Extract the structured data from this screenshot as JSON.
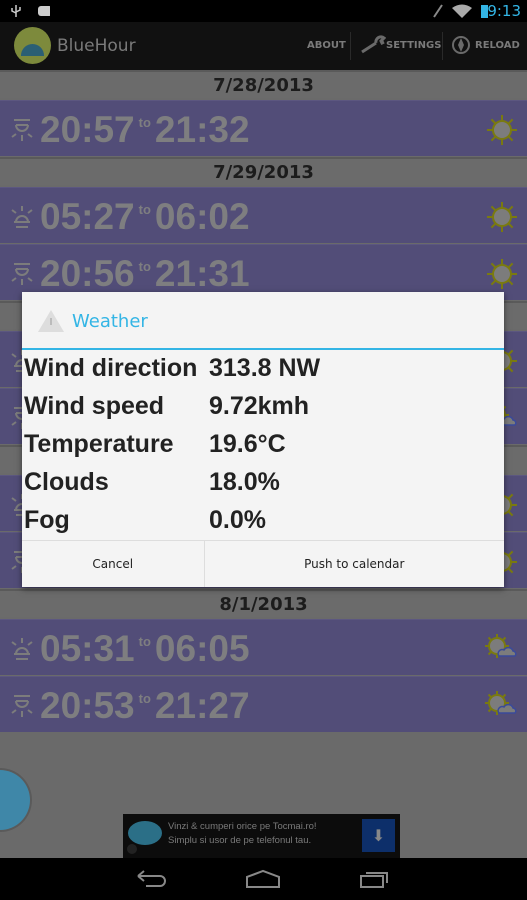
{
  "status_bar": {
    "time": "9:13"
  },
  "action_bar": {
    "title": "BlueHour",
    "about": "ABOUT",
    "settings": "SETTINGS",
    "reload": "RELOAD"
  },
  "list": [
    {
      "kind": "date",
      "label": "7/28/2013"
    },
    {
      "kind": "row",
      "event": "sunset",
      "start": "20:57",
      "to": "to",
      "end": "21:32",
      "weather": "sun"
    },
    {
      "kind": "date",
      "label": "7/29/2013"
    },
    {
      "kind": "row",
      "event": "sunrise",
      "start": "05:27",
      "to": "to",
      "end": "06:02",
      "weather": "sun"
    },
    {
      "kind": "row",
      "event": "sunset",
      "start": "20:56",
      "to": "to",
      "end": "21:31",
      "weather": "sun"
    },
    {
      "kind": "date",
      "label": ""
    },
    {
      "kind": "row",
      "event": "sunrise",
      "weather": "sun"
    },
    {
      "kind": "row",
      "event": "sunset",
      "weather": "sun-cloud"
    },
    {
      "kind": "date",
      "label": ""
    },
    {
      "kind": "row",
      "event": "sunrise",
      "weather": "sun"
    },
    {
      "kind": "row",
      "event": "sunset",
      "weather": "sun"
    },
    {
      "kind": "date",
      "label": "8/1/2013"
    },
    {
      "kind": "row",
      "event": "sunrise",
      "start": "05:31",
      "to": "to",
      "end": "06:05",
      "weather": "sun-cloud"
    },
    {
      "kind": "row",
      "event": "sunset",
      "start": "20:53",
      "to": "to",
      "end": "21:27",
      "weather": "sun-cloud"
    }
  ],
  "dialog": {
    "title": "Weather",
    "rows": [
      {
        "label": "Wind direction",
        "value": "313.8 NW"
      },
      {
        "label": "Wind speed",
        "value": "9.72kmh"
      },
      {
        "label": "Temperature",
        "value": "19.6°C"
      },
      {
        "label": "Clouds",
        "value": "18.0%"
      },
      {
        "label": "Fog",
        "value": "0.0%"
      }
    ],
    "cancel": "Cancel",
    "push": "Push to calendar"
  },
  "ad": {
    "line1": "Vinzi & cumperi orice pe Tocmai.ro!",
    "line2": "Simplu si usor de pe telefonul tau."
  },
  "colors": {
    "accent": "#33b5e5",
    "row_bg": "#524d78",
    "header_bg": "#6b6b6b"
  }
}
